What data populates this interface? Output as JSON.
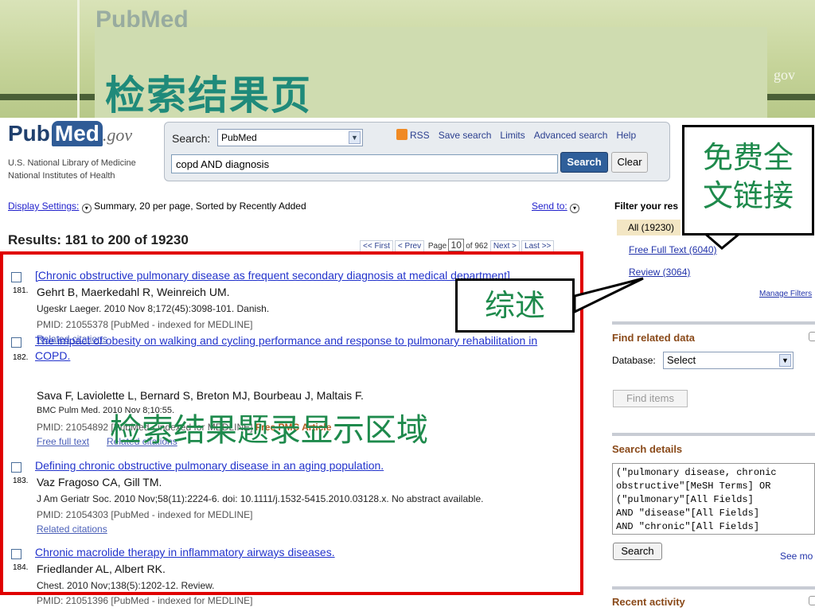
{
  "slide": {
    "title": "检索结果页",
    "gov_faint": "gov",
    "overlay_label": "检索结果题录显示区域",
    "callout_review": "综述",
    "callout_free_line1": "免费全",
    "callout_free_line2": "文链接"
  },
  "logo": {
    "pub": "Pub",
    "med": "Med",
    "gov": ".gov",
    "org_line1": "U.S. National Library of Medicine",
    "org_line2": "National Institutes of Health"
  },
  "search": {
    "label": "Search:",
    "database": "PubMed",
    "query": "copd AND diagnosis",
    "search_button": "Search",
    "clear_button": "Clear",
    "links": [
      "RSS",
      "Save search",
      "Limits",
      "Advanced search",
      "Help"
    ]
  },
  "display": {
    "settings_label": "Display Settings:",
    "settings_value": "Summary, 20 per page, Sorted by Recently Added",
    "send_to": "Send to:"
  },
  "results": {
    "heading": "Results: 181 to 200 of 19230",
    "pager": {
      "first": "<< First",
      "prev": "< Prev",
      "page_label": "Page",
      "page": "10",
      "of": "of 962",
      "next": "Next >",
      "last": "Last >>"
    },
    "items": [
      {
        "num": "181.",
        "title": "[Chronic obstructive pulmonary disease as frequent secondary diagnosis at medical department]",
        "authors": "Gehrt B, Maerkedahl R, Weinreich UM.",
        "journal": "Ugeskr Laeger. 2010 Nov 8;172(45):3098-101. Danish.",
        "pmid": "PMID: 21055378 [PubMed - indexed for MEDLINE]",
        "links": "Related citations"
      },
      {
        "num": "182.",
        "title": "The impact of obesity on walking and cycling performance and response to pulmonary rehabilitation in",
        "title2": "COPD.",
        "authors": "Sava F, Laviolette L, Bernard S, Breton MJ, Bourbeau J, Maltais F.",
        "journal": "BMC Pulm Med. 2010 Nov 8;10:55.",
        "pmid": "PMID: 21054892 [PubMed - indexed for MEDLINE]",
        "free_pmc": "Free PMC Article",
        "links": "Free full text",
        "links2": "Related citations"
      },
      {
        "num": "183.",
        "title": "Defining chronic obstructive pulmonary disease in an aging population.",
        "authors": "Vaz Fragoso CA, Gill TM.",
        "journal": "J Am Geriatr Soc. 2010 Nov;58(11):2224-6. doi: 10.1111/j.1532-5415.2010.03128.x. No abstract available.",
        "pmid": "PMID: 21054303 [PubMed - indexed for MEDLINE]",
        "links": "Related citations"
      },
      {
        "num": "184.",
        "title": "Chronic macrolide therapy in inflammatory airways diseases.",
        "authors": "Friedlander AL, Albert RK.",
        "journal": "Chest. 2010 Nov;138(5):1202-12. Review.",
        "pmid": "PMID: 21051396 [PubMed - indexed for MEDLINE]"
      }
    ]
  },
  "sidebar": {
    "filter_title": "Filter your res",
    "all": "All (19230)",
    "free_full_text": "Free Full Text (6040)",
    "review": "Review (3064)",
    "manage_filters": "Manage Filters",
    "related_title": "Find related data",
    "database_label": "Database:",
    "database_value": "Select",
    "find_items": "Find items",
    "details_title": "Search details",
    "details_text": "(\"pulmonary disease, chronic\nobstructive\"[MeSH Terms] OR\n(\"pulmonary\"[All Fields]\nAND \"disease\"[All Fields]\nAND \"chronic\"[All Fields]",
    "search_button": "Search",
    "see_more": "See mo",
    "recent_title": "Recent activity"
  }
}
